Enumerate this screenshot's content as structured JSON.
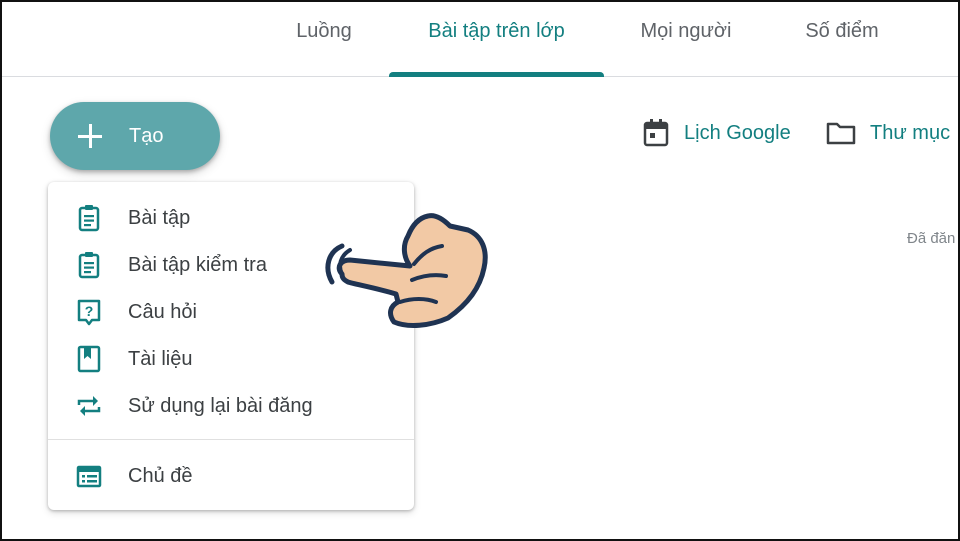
{
  "tabs": [
    {
      "label": "Luồng",
      "active": false
    },
    {
      "label": "Bài tập trên lớp",
      "active": true
    },
    {
      "label": "Mọi người",
      "active": false
    },
    {
      "label": "Số điểm",
      "active": false
    }
  ],
  "create_button": {
    "label": "Tạo",
    "icon": "plus-icon"
  },
  "links": {
    "calendar": {
      "label": "Lịch Google",
      "icon": "calendar-icon"
    },
    "folder": {
      "label": "Thư mục",
      "icon": "folder-icon"
    }
  },
  "posted_text": "Đã đăn",
  "menu": {
    "items": [
      {
        "label": "Bài tập",
        "icon": "assignment-icon"
      },
      {
        "label": "Bài tập kiểm tra",
        "icon": "quiz-assignment-icon"
      },
      {
        "label": "Câu hỏi",
        "icon": "question-icon"
      },
      {
        "label": "Tài liệu",
        "icon": "material-icon"
      },
      {
        "label": "Sử dụng lại bài đăng",
        "icon": "reuse-icon"
      },
      {
        "label": "Chủ đề",
        "icon": "topic-icon"
      }
    ]
  },
  "colors": {
    "accent": "#137f80",
    "button": "#5ea7ab",
    "hand_fill": "#f2c9a5",
    "hand_stroke": "#1f3352"
  }
}
